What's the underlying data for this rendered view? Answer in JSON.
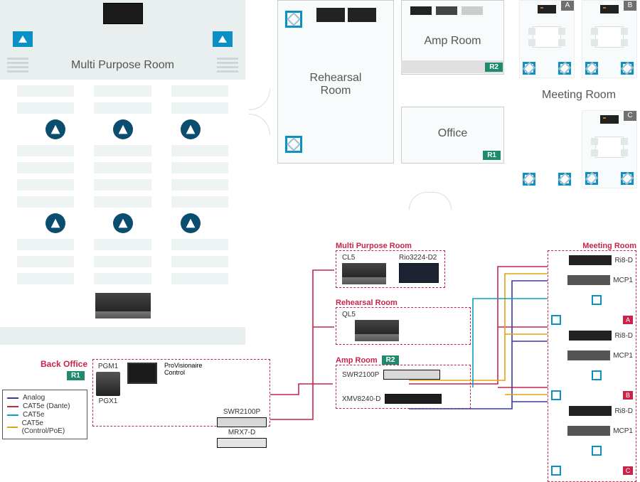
{
  "rooms": {
    "multi_purpose": {
      "label": "Multi Purpose Room"
    },
    "rehearsal": {
      "label": "Rehearsal\nRoom"
    },
    "amp": {
      "label": "Amp Room",
      "badge": "R2"
    },
    "office": {
      "label": "Office",
      "badge": "R1"
    },
    "meeting": {
      "label": "Meeting Room",
      "tiles": [
        "A",
        "B",
        "C"
      ]
    }
  },
  "back_office": {
    "label": "Back Office",
    "badge": "R1"
  },
  "legend": [
    {
      "label": "Analog",
      "color": "#3a3aa0"
    },
    {
      "label": "CAT5e (Dante)",
      "color": "#c8244a"
    },
    {
      "label": "CAT5e",
      "color": "#0aa2c4"
    },
    {
      "label": "CAT5e (Control/PoE)",
      "color": "#e2a412"
    }
  ],
  "system_diagram": {
    "multi_purpose": {
      "title": "Multi Purpose Room",
      "devices": [
        "CL5",
        "Rio3224-D2"
      ]
    },
    "rehearsal": {
      "title": "Rehearsal Room",
      "devices": [
        "QL5"
      ]
    },
    "amp": {
      "title": "Amp Room",
      "badge": "R2",
      "devices": [
        "SWR2100P",
        "XMV8240-D"
      ]
    },
    "back_office": {
      "devices": [
        "PGM1",
        "PGX1",
        "ProVisionaire Control",
        "SWR2100P",
        "MRX7-D"
      ]
    },
    "meeting": {
      "title": "Meeting Room",
      "groups": [
        {
          "tag": "A",
          "devices": [
            "Ri8-D",
            "MCP1"
          ]
        },
        {
          "tag": "B",
          "devices": [
            "Ri8-D",
            "MCP1"
          ]
        },
        {
          "tag": "C",
          "devices": [
            "Ri8-D",
            "MCP1"
          ]
        }
      ]
    }
  }
}
